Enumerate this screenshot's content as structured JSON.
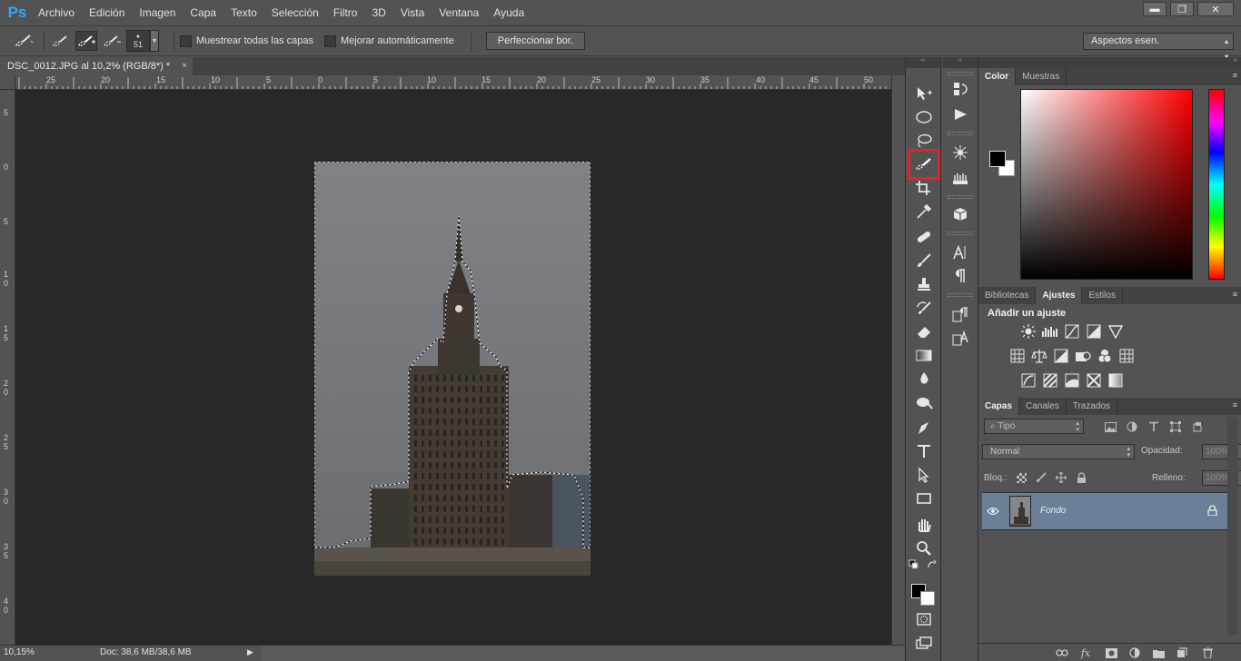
{
  "app": {
    "logo": "Ps",
    "menu": [
      "Archivo",
      "Edición",
      "Imagen",
      "Capa",
      "Texto",
      "Selección",
      "Filtro",
      "3D",
      "Vista",
      "Ventana",
      "Ayuda"
    ],
    "window_controls": {
      "minimize": "▬",
      "restore": "❐",
      "close": "✕"
    }
  },
  "options": {
    "brush_size": "51",
    "sample_all_layers_label": "Muestrear todas las capas",
    "auto_enhance_label": "Mejorar automáticamente",
    "refine_edge_label": "Perfeccionar bor.",
    "workspace": "Aspectos esen."
  },
  "document": {
    "tab_title": "DSC_0012.JPG al 10,2% (RGB/8*) *",
    "close_glyph": "×",
    "zoom": "10,15%",
    "doc_info": "Doc: 38,6 MB/38,6 MB",
    "status_arrow": "▶"
  },
  "rulers": {
    "top": [
      "25",
      "20",
      "15",
      "10",
      "5",
      "0",
      "5",
      "10",
      "15",
      "20",
      "25",
      "30",
      "35",
      "40",
      "45",
      "50"
    ],
    "left": [
      "5",
      "0",
      "5",
      "10",
      "15",
      "20",
      "25",
      "30",
      "35",
      "40"
    ]
  },
  "tools": {
    "highlighted": "quick-selection-tool",
    "highlight_color": "#e5222a"
  },
  "panels": {
    "collapse_glyph": "‹‹",
    "color_tabs": [
      "Color",
      "Muestras"
    ],
    "color_active_tab": "Color",
    "foreground": "#000000",
    "background": "#ffffff",
    "adjust_tabs": [
      "Bibliotecas",
      "Ajustes",
      "Estilos"
    ],
    "adjust_active_tab": "Ajustes",
    "adjust_title": "Añadir un ajuste",
    "layers_tabs": [
      "Capas",
      "Canales",
      "Trazados"
    ],
    "layers_active_tab": "Capas",
    "panel_menu_glyph": "≡",
    "kind_filter": "Tipo",
    "blend_mode": "Normal",
    "opacity_label": "Opacidad:",
    "opacity_value": "100%",
    "lock_label": "Bloq.:",
    "fill_label": "Relleno:",
    "fill_value": "100%",
    "layer_name": "Fondo",
    "selected_layer_color": "#6c7f98"
  }
}
